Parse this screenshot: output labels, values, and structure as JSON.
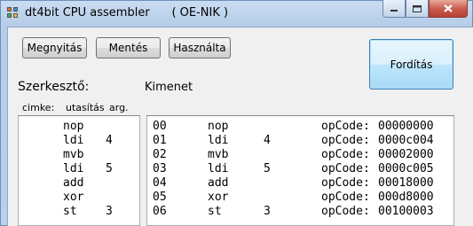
{
  "window": {
    "title": "dt4bit CPU assembler      ( OE-NIK )",
    "controls": {
      "minimize": "minimize",
      "maximize": "maximize",
      "close": "close"
    }
  },
  "toolbar": {
    "open_label": "Megnyitás",
    "save_label": "Mentés",
    "usage_label": "Használta",
    "compile_label": "Fordítás"
  },
  "editor": {
    "title": "Szerkesztő:",
    "columns": [
      "cimke:",
      "utasítás",
      "arg."
    ],
    "lines": [
      {
        "label": "",
        "instr": "nop",
        "arg": ""
      },
      {
        "label": "",
        "instr": "ldi",
        "arg": "4"
      },
      {
        "label": "",
        "instr": "mvb",
        "arg": ""
      },
      {
        "label": "",
        "instr": "ldi",
        "arg": "5"
      },
      {
        "label": "",
        "instr": "add",
        "arg": ""
      },
      {
        "label": "",
        "instr": "xor",
        "arg": ""
      },
      {
        "label": "",
        "instr": "st",
        "arg": "3"
      }
    ]
  },
  "output": {
    "title": "Kimenet",
    "lines": [
      {
        "addr": "00",
        "instr": "nop",
        "arg": "",
        "key": "opCode:",
        "code": "00000000"
      },
      {
        "addr": "01",
        "instr": "ldi",
        "arg": "4",
        "key": "opCode:",
        "code": "0000c004"
      },
      {
        "addr": "02",
        "instr": "mvb",
        "arg": "",
        "key": "opCode:",
        "code": "00002000"
      },
      {
        "addr": "03",
        "instr": "ldi",
        "arg": "5",
        "key": "opCode:",
        "code": "0000c005"
      },
      {
        "addr": "04",
        "instr": "add",
        "arg": "",
        "key": "opCode:",
        "code": "00018000"
      },
      {
        "addr": "05",
        "instr": "xor",
        "arg": "",
        "key": "opCode:",
        "code": "000d8000"
      },
      {
        "addr": "06",
        "instr": "st",
        "arg": "3",
        "key": "opCode:",
        "code": "00100003"
      }
    ]
  },
  "colors": {
    "titlebar": "#b9d1ea",
    "close_button": "#c8594a",
    "default_button_border": "#3c7fb1"
  }
}
